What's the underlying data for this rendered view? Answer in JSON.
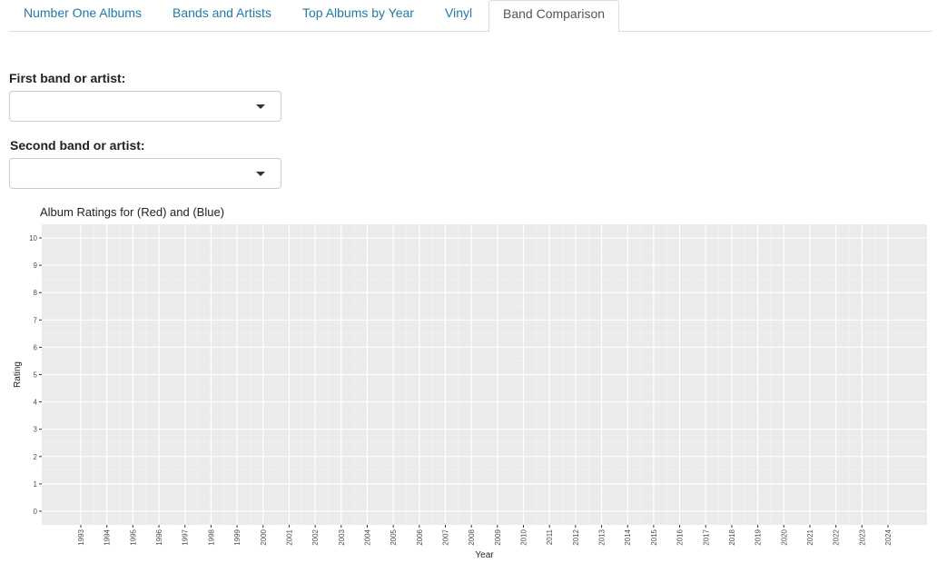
{
  "tabs": [
    {
      "label": "Number One Albums"
    },
    {
      "label": "Bands and Artists"
    },
    {
      "label": "Top Albums by Year"
    },
    {
      "label": "Vinyl"
    },
    {
      "label": "Band Comparison"
    }
  ],
  "active_tab": "Band Comparison",
  "first_select": {
    "label": "First band or artist:",
    "value": ""
  },
  "second_select": {
    "label": "Second band or artist:",
    "value": ""
  },
  "chart_data": {
    "type": "scatter",
    "title": "Album Ratings for  (Red) and  (Blue)",
    "xlabel": "Year",
    "ylabel": "Rating",
    "x_ticks": [
      "1993",
      "1994",
      "1995",
      "1996",
      "1997",
      "1998",
      "1999",
      "2000",
      "2001",
      "2002",
      "2003",
      "2004",
      "2005",
      "2006",
      "2007",
      "2008",
      "2009",
      "2010",
      "2011",
      "2012",
      "2013",
      "2014",
      "2015",
      "2016",
      "2017",
      "2018",
      "2019",
      "2020",
      "2021",
      "2022",
      "2023",
      "2024"
    ],
    "y_ticks": [
      0,
      1,
      2,
      3,
      4,
      5,
      6,
      7,
      8,
      9,
      10
    ],
    "xlim": [
      1991.5,
      2025.5
    ],
    "ylim": [
      -0.5,
      10.5
    ],
    "grid": true,
    "panel_color": "#ebebeb",
    "series": [
      {
        "color": "#ff0000",
        "points": []
      },
      {
        "color": "#0000ff",
        "points": []
      }
    ]
  }
}
